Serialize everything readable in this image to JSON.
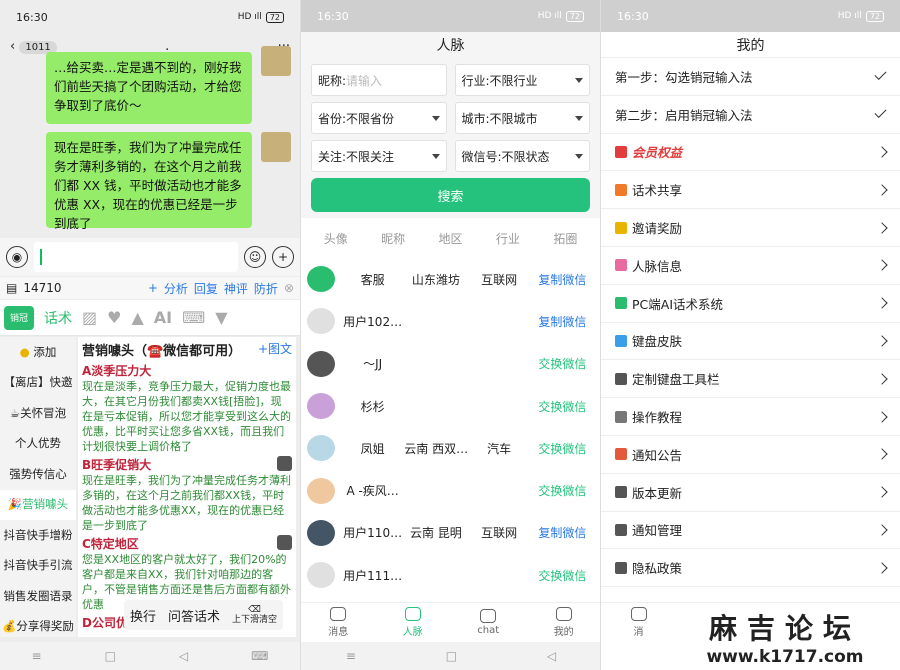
{
  "time": "16:30",
  "p1": {
    "chat_count": "1011",
    "chat_title": ".",
    "bubble1": "…给买卖…定是遇不到的，刚好我们前些天搞了个团购活动，才给您争取到了底价～",
    "bubble2": "现在是旺季，我们为了冲量完成任务才薄利多销的，在这个月之前我们都 XX 钱，平时做活动也才能多优惠 XX，现在的优惠已经是一步到底了",
    "kb_id": "14710",
    "kb_actions": [
      "分析",
      "回复",
      "神评",
      "防折"
    ],
    "tool_label": "话术",
    "categories": [
      "添加",
      "【离店】快邀",
      "☕关怀冒泡",
      "个人优势",
      "强势传信心",
      "🎉营销噱头",
      "抖音快手增粉",
      "抖音快手引流",
      "销售发圈语录",
      "💰分享得奖励"
    ],
    "scripts_title": "营销噱头（☎️微信都可用）",
    "add_image": "+图文",
    "items": [
      {
        "title": "A淡季压力大",
        "body": "现在是淡季，竞争压力最大，促销力度也最大，在其它月份我们都卖XX钱[捂脸]，现在是亏本促销，所以您才能享受到这么大的优惠，比平时买让您多省XX钱，而且我们计划很快要上调价格了"
      },
      {
        "title": "B旺季促销大",
        "body": "现在是旺季，我们为了冲量完成任务才薄利多销的，在这个月之前我们都XX钱，平时做活动也才能多优惠XX，现在的优惠已经是一步到底了"
      },
      {
        "title": "C特定地区",
        "body": "您是XX地区的客户就太好了，我们20%的客户都是来自XX，我们针对咱那边的客户，不管是销售方面还是售后方面都有额外优惠"
      },
      {
        "title": "D公司优势",
        "body": ""
      }
    ],
    "float_btns": [
      "换行",
      "问答话术"
    ],
    "float_hint": "上下滑清空"
  },
  "p2": {
    "title": "人脉",
    "nick_label": "昵称:",
    "nick_placeholder": "请输入",
    "industry": "行业:不限行业",
    "province": "省份:不限省份",
    "city": "城市:不限城市",
    "follow": "关注:不限关注",
    "wechat": "微信号:不限状态",
    "search": "搜索",
    "headers": [
      "头像",
      "昵称",
      "地区",
      "行业",
      "拓圈"
    ],
    "rows": [
      {
        "name": "客服",
        "region": "山东潍坊",
        "industry": "互联网",
        "action": "复制微信",
        "kind": "copy"
      },
      {
        "name": "用户102…",
        "region": "",
        "industry": "",
        "action": "复制微信",
        "kind": "copy"
      },
      {
        "name": "～JJ",
        "region": "",
        "industry": "",
        "action": "交换微信",
        "kind": "swap"
      },
      {
        "name": "杉杉",
        "region": "",
        "industry": "",
        "action": "交换微信",
        "kind": "swap"
      },
      {
        "name": "凤姐",
        "region": "云南 西双…",
        "industry": "汽车",
        "action": "交换微信",
        "kind": "swap"
      },
      {
        "name": "A -疾风…",
        "region": "",
        "industry": "",
        "action": "交换微信",
        "kind": "swap"
      },
      {
        "name": "用户110…",
        "region": "云南 昆明",
        "industry": "互联网",
        "action": "复制微信",
        "kind": "copy"
      },
      {
        "name": "用户111…",
        "region": "",
        "industry": "",
        "action": "交换微信",
        "kind": "swap"
      }
    ],
    "tabs": [
      "消息",
      "人脉",
      "chat",
      "我的"
    ]
  },
  "p3": {
    "title": "我的",
    "items": [
      {
        "label": "第一步：勾选销冠输入法",
        "mark": "check"
      },
      {
        "label": "第二步：启用销冠输入法",
        "mark": "check"
      },
      {
        "label": "会员权益",
        "mark": "chev",
        "vip": true,
        "color": "#e23c3c"
      },
      {
        "label": "话术共享",
        "mark": "chev",
        "color": "#f07a2a"
      },
      {
        "label": "邀请奖励",
        "mark": "chev",
        "color": "#e8b400"
      },
      {
        "label": "人脉信息",
        "mark": "chev",
        "color": "#e86aa0"
      },
      {
        "label": "PC端AI话术系统",
        "mark": "chev",
        "color": "#2bbd6f"
      },
      {
        "label": "键盘皮肤",
        "mark": "chev",
        "color": "#3a9ee8"
      },
      {
        "label": "定制键盘工具栏",
        "mark": "chev",
        "color": "#555555"
      },
      {
        "label": "操作教程",
        "mark": "chev",
        "color": "#777777"
      },
      {
        "label": "通知公告",
        "mark": "chev",
        "color": "#e25a3a"
      },
      {
        "label": "版本更新",
        "mark": "chev",
        "color": "#555555"
      },
      {
        "label": "通知管理",
        "mark": "chev",
        "color": "#555555"
      },
      {
        "label": "隐私政策",
        "mark": "chev",
        "color": "#555555"
      }
    ],
    "tab_first": "消"
  },
  "watermark": {
    "cn": "麻吉论坛",
    "url": "www.k1717.com"
  }
}
